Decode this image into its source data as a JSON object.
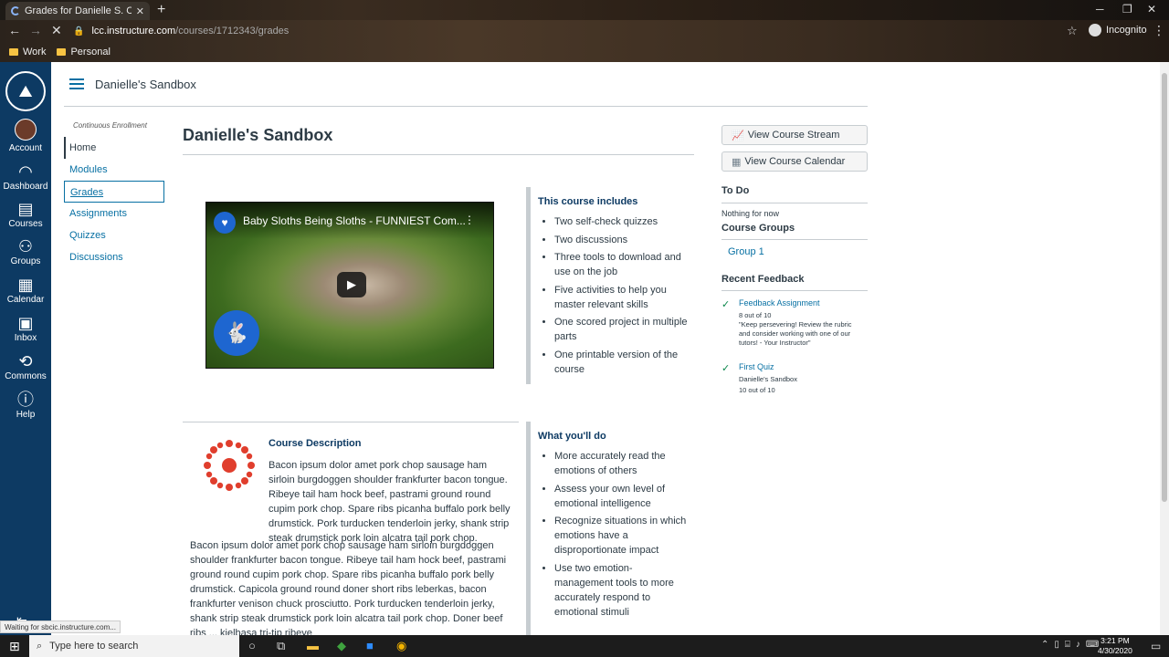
{
  "browser": {
    "tab_title": "Grades for Danielle S. Casey: Da",
    "url_host": "lcc.instructure.com",
    "url_path": "/courses/1712343/grades",
    "profile": "Incognito",
    "bookmarks": [
      "Work",
      "Personal"
    ],
    "status": "Waiting for sbcic.instructure.com..."
  },
  "global_nav": {
    "items": [
      "Account",
      "Dashboard",
      "Courses",
      "Groups",
      "Calendar",
      "Inbox",
      "Commons",
      "Help"
    ]
  },
  "header": {
    "breadcrumb": "Danielle's Sandbox"
  },
  "course_nav": {
    "enrollment": "Continuous Enrollment",
    "items": [
      "Home",
      "Modules",
      "Grades",
      "Assignments",
      "Quizzes",
      "Discussions"
    ]
  },
  "main": {
    "title": "Danielle's Sandbox",
    "video_title": "Baby Sloths Being Sloths - FUNNIEST Com...",
    "includes": {
      "title": "This course includes",
      "items": [
        "Two self-check quizzes",
        "Two discussions",
        "Three tools to download and use on the job",
        "Five activities to help you master relevant skills",
        "One scored project in multiple parts",
        "One printable version of the course"
      ]
    },
    "description": {
      "title": "Course Description",
      "p1": "Bacon ipsum dolor amet pork chop sausage ham sirloin burgdoggen shoulder frankfurter bacon tongue. Ribeye tail ham hock beef, pastrami ground round cupim pork chop. Spare ribs picanha buffalo pork belly drumstick. Pork turducken tenderloin jerky, shank strip steak drumstick pork loin alcatra tail pork chop.",
      "p2": "Bacon ipsum dolor amet pork chop sausage ham sirloin burgdoggen shoulder frankfurter bacon tongue. Ribeye tail ham hock beef, pastrami ground round cupim pork chop. Spare ribs picanha buffalo pork belly drumstick. Capicola ground round doner short ribs leberkas, bacon frankfurter venison chuck prosciutto. Pork turducken tenderloin jerky, shank strip steak drumstick pork loin alcatra tail pork chop. Doner beef ribs ... kielbasa tri-tip ribeye"
    },
    "what_youll_do": {
      "title": "What you'll do",
      "items": [
        "More accurately read the emotions of others",
        "Assess your own level of emotional intelligence",
        "Recognize situations in which emotions have a disproportionate impact",
        "Use two emotion-management tools to more accurately respond to emotional stimuli"
      ]
    }
  },
  "sidebar": {
    "view_stream": "View Course Stream",
    "view_calendar": "View Course Calendar",
    "todo_title": "To Do",
    "todo_empty": "Nothing for now",
    "groups_title": "Course Groups",
    "group1": "Group 1",
    "feedback_title": "Recent Feedback",
    "feedback": [
      {
        "title": "Feedback Assignment",
        "score": "8 out of 10",
        "comment": "\"Keep persevering! Review the rubric and consider working with one of our tutors! - Your Instructor\""
      },
      {
        "title": "First Quiz",
        "course": "Danielle's Sandbox",
        "score": "10 out of 10"
      }
    ]
  },
  "taskbar": {
    "search_placeholder": "Type here to search",
    "time": "3:21 PM",
    "date": "4/30/2020"
  }
}
